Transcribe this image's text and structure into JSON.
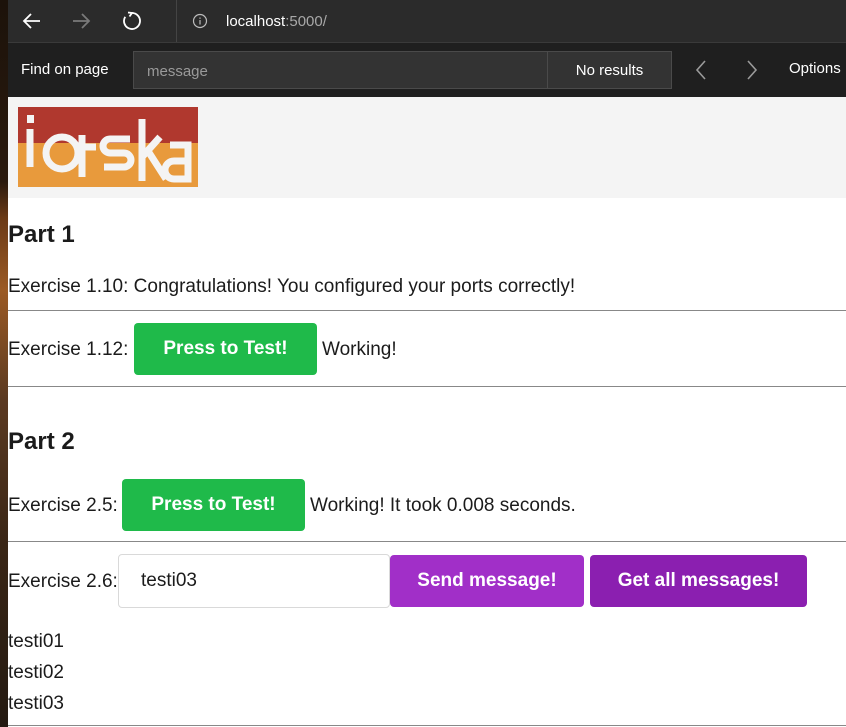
{
  "browser": {
    "url_host": "localhost",
    "url_rest": ":5000/"
  },
  "findbar": {
    "label": "Find on page",
    "placeholder": "message",
    "results": "No results",
    "options_label": "Options"
  },
  "part1": {
    "title": "Part 1",
    "ex110_text": "Exercise 1.10: Congratulations! You configured your ports correctly!",
    "ex112_label": "Exercise 1.12:",
    "ex112_button": "Press to Test!",
    "ex112_status": "Working!"
  },
  "part2": {
    "title": "Part 2",
    "ex25_label": "Exercise 2.5:",
    "ex25_button": "Press to Test!",
    "ex25_status": "Working! It took 0.008 seconds.",
    "ex26_label": "Exercise 2.6:",
    "ex26_input_value": "testi03",
    "send_button": "Send message!",
    "get_button": "Get all messages!",
    "messages": [
      "testi01",
      "testi02",
      "testi03"
    ]
  },
  "colors": {
    "green_button": "#1fba4a",
    "purple_button": "#a12fc8",
    "purple_button_dark": "#8b1fb0",
    "logo_red": "#b0382e",
    "logo_orange": "#e89a3c"
  }
}
